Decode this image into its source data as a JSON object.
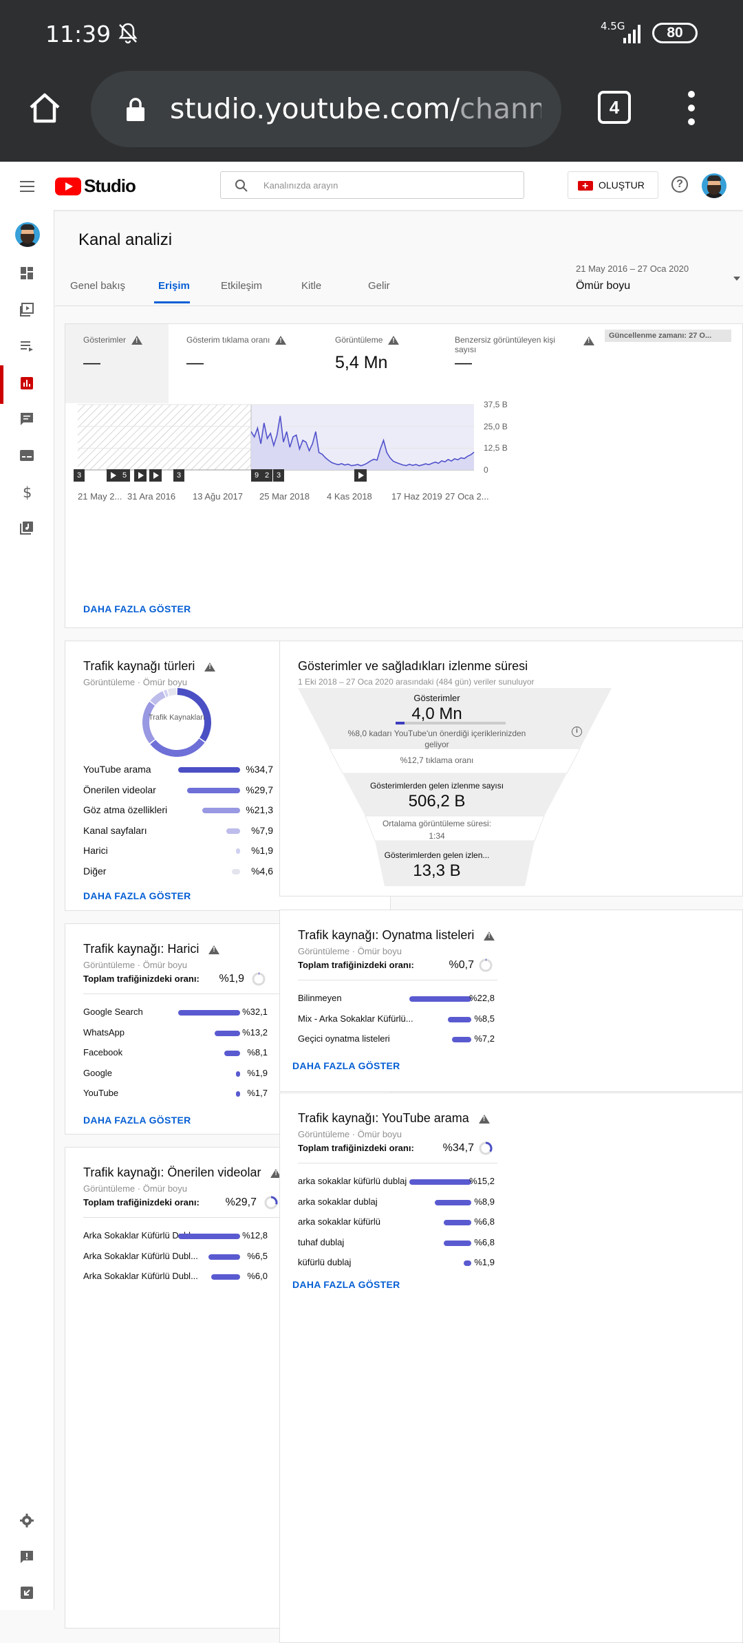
{
  "status_bar": {
    "time": "11:39",
    "network": "4.5G",
    "battery": "80"
  },
  "browser": {
    "url_main": "studio.youtube.com/",
    "url_dim": "channe",
    "tab_count": "4"
  },
  "app": {
    "logo_text": "Studio",
    "search_placeholder": "Kanalınızda arayın",
    "create_label": "OLUŞTUR"
  },
  "page": {
    "title": "Kanal analizi",
    "tabs": [
      "Genel bakış",
      "Erişim",
      "Etkileşim",
      "Kitle",
      "Gelir"
    ],
    "selected_tab": "Erişim",
    "date_range": "21 May 2016 – 27 Oca 2020",
    "range_label": "Ömür boyu"
  },
  "metrics": {
    "items": [
      {
        "label": "Gösterimler",
        "value": "—"
      },
      {
        "label": "Gösterim tıklama oranı",
        "value": "—"
      },
      {
        "label": "Görüntüleme",
        "value": "5,4 Mn"
      },
      {
        "label": "Benzersiz görüntüleyen kişi sayısı",
        "value": "—"
      }
    ],
    "update_badge": "Güncellenme zamanı: 27 O...",
    "show_more": "DAHA FAZLA GÖSTER"
  },
  "chart_data": {
    "type": "line",
    "x_tick_labels": [
      "21 May 2...",
      "31 Ara 2016",
      "13 Ağu 2017",
      "25 Mar 2018",
      "4 Kas 2018",
      "17 Haz 2019",
      "27 Oca 2..."
    ],
    "y_tick_labels": [
      "37,5 B",
      "25,0 B",
      "12,5 B",
      "0"
    ],
    "ylim": [
      0,
      37500
    ],
    "series": [
      {
        "values": [
          22000,
          19000,
          24000,
          15000,
          27000,
          18000,
          21000,
          14000,
          20000,
          31000,
          16000,
          22000,
          13000,
          19000,
          20000,
          12000,
          17000,
          16000,
          11000,
          15000,
          22000,
          10000,
          9000,
          7000,
          5500,
          4200,
          3500,
          3000,
          3600,
          2800,
          3300,
          2500,
          2700,
          3100,
          2400,
          3000,
          4000,
          5200,
          6100,
          5600,
          12000,
          17000,
          10000,
          7000,
          5000,
          4200,
          3500,
          2800,
          2500,
          3200,
          2600,
          3100,
          2400,
          2900,
          3500,
          3000,
          3800,
          4500,
          3800,
          5200,
          4600,
          6000,
          5100,
          6400,
          5800,
          7000,
          6500,
          7800,
          8700,
          10200
        ]
      }
    ],
    "events": [
      "3",
      "play",
      "5",
      "play",
      "play",
      "3",
      "9",
      "2",
      "3",
      "play"
    ],
    "grid": true,
    "shaded_region": "21 May 2016 – 25 Mar 2018"
  },
  "traffic_types": {
    "title": "Trafik kaynağı türleri",
    "subtitle": "Görüntüleme · Ömür boyu",
    "donut_label": "Trafik Kaynakları",
    "rows": [
      {
        "label": "YouTube arama",
        "pct": 34.7,
        "value": "%34,7",
        "color": "#4b4fc4"
      },
      {
        "label": "Önerilen videolar",
        "pct": 29.7,
        "value": "%29,7",
        "color": "#6f6fd8"
      },
      {
        "label": "Göz atma özellikleri",
        "pct": 21.3,
        "value": "%21,3",
        "color": "#9998e2"
      },
      {
        "label": "Kanal sayfaları",
        "pct": 7.9,
        "value": "%7,9",
        "color": "#bdbceb"
      },
      {
        "label": "Harici",
        "pct": 1.9,
        "value": "%1,9",
        "color": "#d0d0f0"
      },
      {
        "label": "Diğer",
        "pct": 4.6,
        "value": "%4,6",
        "color": "#e4e4ee"
      }
    ],
    "show_more": "DAHA FAZLA GÖSTER"
  },
  "funnel": {
    "title": "Gösterimler ve sağladıkları izlenme süresi",
    "subtitle": "1 Eki 2018 – 27 Oca 2020 arasındaki (484 gün) veriler sunuluyor",
    "impressions_label": "Gösterimler",
    "impressions_value": "4,0 Mn",
    "impressions_progress": 0.08,
    "recommended_note": "%8,0 kadarı YouTube'un önerdiği içeriklerinizden geliyor",
    "ctr": "%12,7 tıklama oranı",
    "views_label": "Gösterimlerden gelen izlenme sayısı",
    "views_value": "506,2 B",
    "avg_label": "Ortalama görüntüleme süresi:",
    "avg_value": "1:34",
    "watch_label": "Gösterimlerden gelen izlen...",
    "watch_value": "13,3 B"
  },
  "external": {
    "title": "Trafik kaynağı: Harici",
    "subtitle": "Görüntüleme · Ömür boyu",
    "total_label": "Toplam trafiğinizdeki oranı:",
    "total_value": "%1,9",
    "total_pct": 1.9,
    "rows": [
      {
        "label": "Google Search",
        "pct": 32.1,
        "value": "%32,1"
      },
      {
        "label": "WhatsApp",
        "pct": 13.2,
        "value": "%13,2"
      },
      {
        "label": "Facebook",
        "pct": 8.1,
        "value": "%8,1"
      },
      {
        "label": "Google",
        "pct": 1.9,
        "value": "%1,9"
      },
      {
        "label": "YouTube",
        "pct": 1.7,
        "value": "%1,7"
      }
    ],
    "show_more": "DAHA FAZLA GÖSTER"
  },
  "playlists": {
    "title": "Trafik kaynağı: Oynatma listeleri",
    "subtitle": "Görüntüleme · Ömür boyu",
    "total_label": "Toplam trafiğinizdeki oranı:",
    "total_value": "%0,7",
    "total_pct": 0.7,
    "rows": [
      {
        "label": "Bilinmeyen",
        "pct": 22.8,
        "value": "%22,8"
      },
      {
        "label": "Mix - Arka Sokaklar Küfürlü...",
        "pct": 8.5,
        "value": "%8,5"
      },
      {
        "label": "Geçici oynatma listeleri",
        "pct": 7.2,
        "value": "%7,2"
      }
    ],
    "show_more": "DAHA FAZLA GÖSTER"
  },
  "suggested": {
    "title": "Trafik kaynağı: Önerilen videolar",
    "subtitle": "Görüntüleme · Ömür boyu",
    "total_label": "Toplam trafiğinizdeki oranı:",
    "total_value": "%29,7",
    "total_pct": 29.7,
    "rows": [
      {
        "label": "Arka Sokaklar Küfürlü Dubl...",
        "pct": 12.8,
        "value": "%12,8"
      },
      {
        "label": "Arka Sokaklar Küfürlü Dubl...",
        "pct": 6.5,
        "value": "%6,5"
      },
      {
        "label": "Arka Sokaklar Küfürlü Dubl...",
        "pct": 6.0,
        "value": "%6,0"
      }
    ]
  },
  "yt_search": {
    "title": "Trafik kaynağı: YouTube arama",
    "subtitle": "Görüntüleme · Ömür boyu",
    "total_label": "Toplam trafiğinizdeki oranı:",
    "total_value": "%34,7",
    "total_pct": 34.7,
    "rows": [
      {
        "label": "arka sokaklar küfürlü dublaj",
        "pct": 15.2,
        "value": "%15,2"
      },
      {
        "label": "arka sokaklar dublaj",
        "pct": 8.9,
        "value": "%8,9"
      },
      {
        "label": "arka sokaklar küfürlü",
        "pct": 6.8,
        "value": "%6,8"
      },
      {
        "label": "tuhaf dublaj",
        "pct": 6.8,
        "value": "%6,8"
      },
      {
        "label": "küfürlü dublaj",
        "pct": 1.9,
        "value": "%1,9"
      }
    ],
    "show_more": "DAHA FAZLA GÖSTER"
  },
  "colors": {
    "accent": "#065fd4",
    "bar": "#5a5ad0",
    "brand_red": "#ff0000"
  }
}
